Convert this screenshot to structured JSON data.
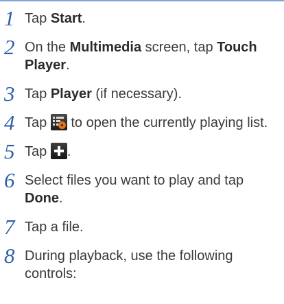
{
  "steps": [
    {
      "num": "1",
      "text_before": "Tap ",
      "bold1": "Start",
      "text_after": "."
    },
    {
      "num": "2",
      "text_before": "On the ",
      "bold1": "Multimedia",
      "text_middle": " screen, tap ",
      "bold2": "Touch Player",
      "text_after": "."
    },
    {
      "num": "3",
      "text_before": "Tap ",
      "bold1": "Player",
      "text_after": " (if necessary)."
    },
    {
      "num": "4",
      "text_before": "Tap ",
      "icon": "playlist-icon",
      "text_after": " to open the currently playing list."
    },
    {
      "num": "5",
      "text_before": "Tap ",
      "icon": "add-icon",
      "text_after": "."
    },
    {
      "num": "6",
      "text_before": "Select files you want to play and tap ",
      "bold1": "Done",
      "text_after": "."
    },
    {
      "num": "7",
      "text_before": "Tap a file."
    },
    {
      "num": "8",
      "text_before": "During playback, use the following controls:"
    }
  ],
  "colors": {
    "number": "#2f5fa8",
    "rule": "#7fa3d6",
    "text": "#3a3a3a",
    "icon_accent": "#e1731d"
  }
}
